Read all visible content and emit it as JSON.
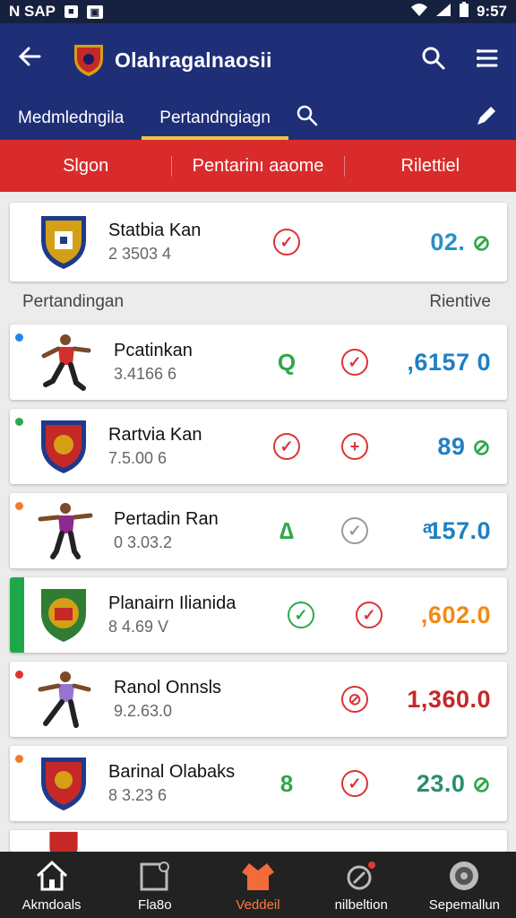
{
  "status": {
    "left_text": "N SAP",
    "time": "9:57"
  },
  "appbar": {
    "title": "Olahragalnaosii"
  },
  "tabs": [
    {
      "label": "Medmledngila"
    },
    {
      "label": "Pertandngiagn"
    }
  ],
  "filters": [
    {
      "label": "Slgon"
    },
    {
      "label": "Pentarinı aaome"
    },
    {
      "label": "Rilettiel"
    }
  ],
  "featured": {
    "name": "Statbia Kan",
    "sub": "2 3503 4",
    "value": "02.",
    "colors": {
      "value": "#2a8fc9"
    }
  },
  "section": {
    "left": "Pertandingan",
    "right": "Rientive"
  },
  "rows": [
    {
      "name": "Pcatinkan",
      "sub": "3.4​1​66 6",
      "value": ",6157 0",
      "dot": "#1e88e5",
      "value_color": "#1f7fc4"
    },
    {
      "name": "Rartvia Kan",
      "sub": "7.5.00 6",
      "value": "89",
      "dot": "#2ea84a",
      "value_color": "#1f7fc4"
    },
    {
      "name": "Pertadin Ran",
      "sub": "0 3.03.2",
      "value": "ͣ157.0",
      "dot": "#f07a2a",
      "value_color": "#1f7fc4"
    },
    {
      "name": "Planairn Ilianida",
      "sub": "8 4.69 V",
      "value": ",602.0",
      "dot": "#2ea84a",
      "value_color": "#f28a14"
    },
    {
      "name": "Ranol Onnsls",
      "sub": "9.2.63.0",
      "value": "1,360.0",
      "dot": "#e03030",
      "value_color": "#c62828"
    },
    {
      "name": "Barinal Olabaks",
      "sub": "8 3.23 6",
      "value": "23.0",
      "dot": "#f07a2a",
      "value_color": "#2a8f6c"
    }
  ],
  "nav": [
    {
      "label": "Akmdoals"
    },
    {
      "label": "Fla8o"
    },
    {
      "label": "Veddeil"
    },
    {
      "label": "nilbeltion"
    },
    {
      "label": "Sepemallun"
    }
  ]
}
